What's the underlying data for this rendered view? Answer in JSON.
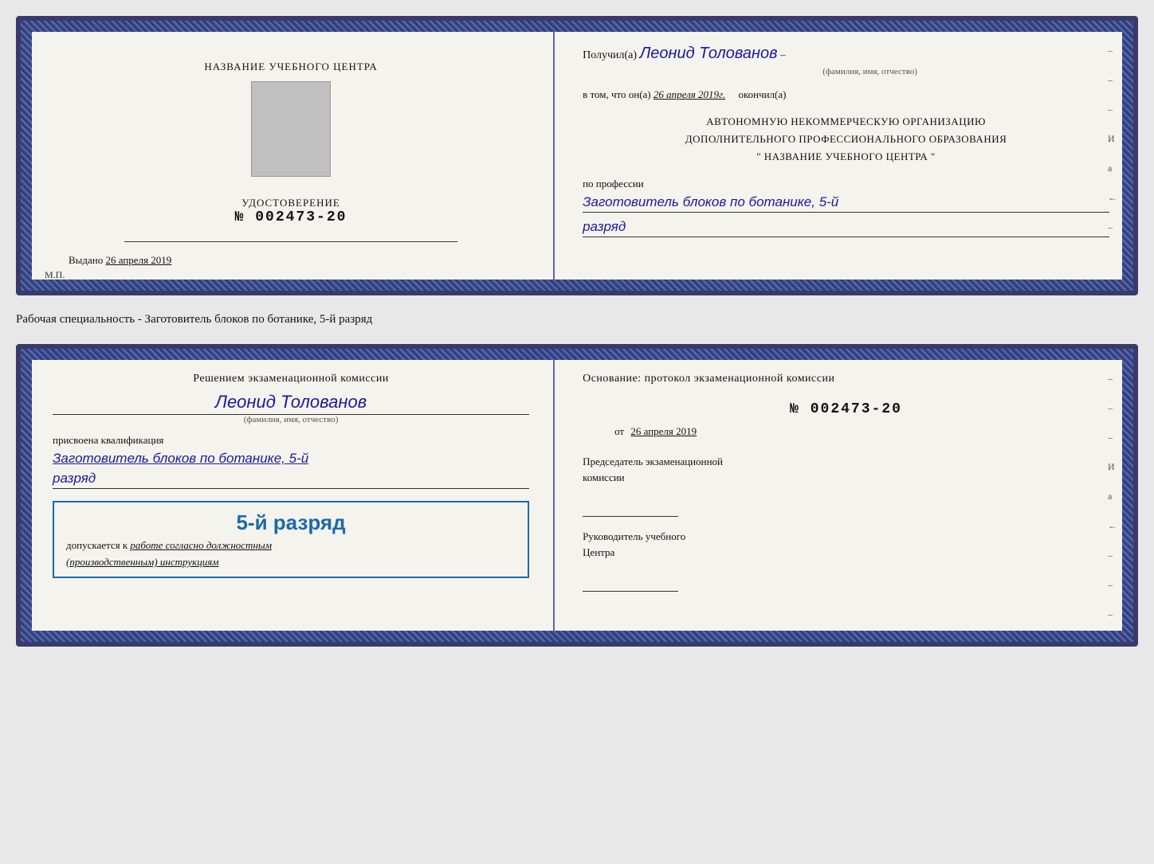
{
  "top_doc": {
    "left": {
      "title_line1": "НАЗВАНИЕ УЧЕБНОГО ЦЕНТРА",
      "cert_label": "УДОСТОВЕРЕНИЕ",
      "cert_no_prefix": "№",
      "cert_no": "002473-20",
      "issued_prefix": "Выдано",
      "issued_date": "26 апреля 2019",
      "mp_label": "М.П."
    },
    "right": {
      "received_prefix": "Получил(а)",
      "recipient_name": "Леонид Толованов",
      "fio_label": "(фамилия, имя, отчество)",
      "confirm_text": "в том, что он(а)",
      "cert_date": "26 апреля 2019г.",
      "finished_word": "окончил(а)",
      "org_line1": "АВТОНОМНУЮ НЕКОММЕРЧЕСКУЮ ОРГАНИЗАЦИЮ",
      "org_line2": "ДОПОЛНИТЕЛЬНОГО ПРОФЕССИОНАЛЬНОГО ОБРАЗОВАНИЯ",
      "org_line3": "\"   НАЗВАНИЕ УЧЕБНОГО ЦЕНТРА   \"",
      "profession_label": "по профессии",
      "profession_value": "Заготовитель блоков по ботанике, 5-й",
      "rank_value": "разряд"
    }
  },
  "between_label": "Рабочая специальность - Заготовитель блоков по ботанике, 5-й разряд",
  "bottom_doc": {
    "left": {
      "decision_text": "Решением экзаменационной комиссии",
      "person_name": "Леонид Толованов",
      "fio_label": "(фамилия, имя, отчество)",
      "qualification_label": "присвоена квалификация",
      "qualification_value": "Заготовитель блоков по ботанике, 5-й",
      "rank_value": "разряд",
      "stamp_rank": "5-й разряд",
      "admission_prefix": "допускается к",
      "admission_text": "работе согласно должностным",
      "admission_text2": "(производственным) инструкциям"
    },
    "right": {
      "basis_label": "Основание: протокол экзаменационной комиссии",
      "protocol_no": "№  002473-20",
      "from_prefix": "от",
      "from_date": "26 апреля 2019",
      "chairman_title_line1": "Председатель экзаменационной",
      "chairman_title_line2": "комиссии",
      "head_title_line1": "Руководитель учебного",
      "head_title_line2": "Центра"
    }
  },
  "side_marks": {
    "marks": [
      "–",
      "–",
      "–",
      "И",
      "а",
      "←",
      "–",
      "–",
      "–",
      "–",
      "–"
    ]
  }
}
